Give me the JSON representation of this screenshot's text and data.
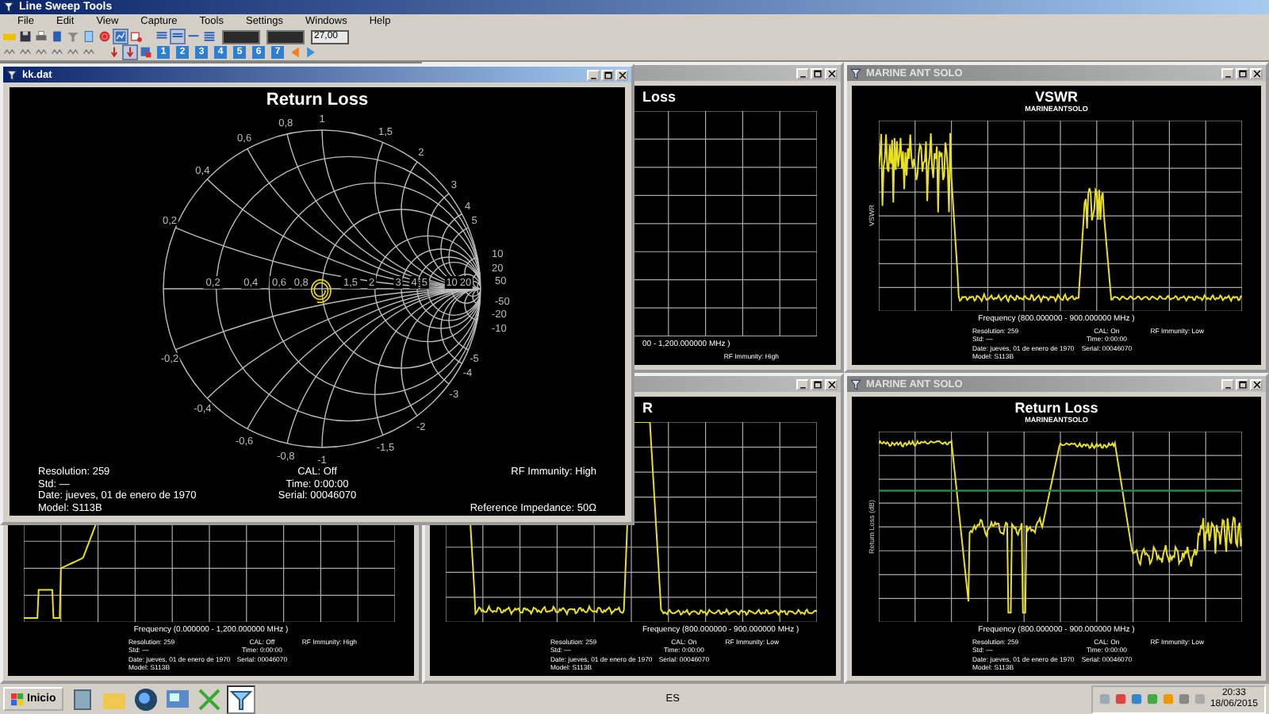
{
  "window": {
    "title": "Line Sweep Tools"
  },
  "menu": [
    {
      "label": "File"
    },
    {
      "label": "Edit"
    },
    {
      "label": "View"
    },
    {
      "label": "Capture"
    },
    {
      "label": "Tools"
    },
    {
      "label": "Settings"
    },
    {
      "label": "Windows"
    },
    {
      "label": "Help"
    }
  ],
  "toolbar": {
    "value": "27,00",
    "number_buttons": [
      "1",
      "2",
      "3",
      "4",
      "5",
      "6",
      "7"
    ]
  },
  "documents": [
    {
      "active": false,
      "chart_title": "Loss",
      "freq": "00 - 1,200.000000 MHz )",
      "info": {
        "right": [
          "RF Immunity: High"
        ]
      }
    },
    {
      "active": false,
      "title": "MARINE ANT SOLO",
      "kind": "vswr",
      "chart_title": "VSWR",
      "subtitle": "MARINEANTSOLO",
      "ylabel": "VSWR",
      "freq": "Frequency (800.000000 - 900.000000 MHz )",
      "info": {
        "left": [
          "Resolution: 259",
          "Std: —",
          "Date: jueves, 01 de enero de 1970",
          "Model: S113B"
        ],
        "center": [
          "CAL: On",
          "Time: 0:00:00",
          "Serial: 00046070"
        ],
        "right": [
          "RF Immunity: Low"
        ]
      }
    },
    {
      "kind": "wide",
      "freq": "Frequency (0.000000 - 1,200.000000 MHz )",
      "info": {
        "left": [
          "Resolution: 259",
          "Std: —",
          "Date: jueves, 01 de enero de 1970",
          "Model: S113B"
        ],
        "center": [
          "CAL: Off",
          "Time: 0:00:00",
          "Serial: 00046070"
        ],
        "right": [
          "RF Immunity: High"
        ]
      }
    },
    {
      "active": false,
      "kind": "vswr2",
      "chart_title": "R",
      "freq": "Frequency (800.000000 - 900.000000 MHz )",
      "info": {
        "left": [
          "Resolution: 259",
          "Std: —",
          "Date: jueves, 01 de enero de 1970",
          "Model: S113B"
        ],
        "center": [
          "CAL: On",
          "Time: 0:00:00",
          "Serial: 00046070"
        ],
        "right": [
          "RF Immunity: Low"
        ]
      }
    },
    {
      "active": false,
      "title": "MARINE ANT SOLO",
      "kind": "rl",
      "limit": true,
      "chart_title": "Return Loss",
      "subtitle": "MARINEANTSOLO",
      "ylabel": "Return Loss (dB)",
      "freq": "Frequency (800.000000 - 900.000000 MHz )",
      "info": {
        "left": [
          "Resolution: 259",
          "Std: —",
          "Date: jueves, 01 de enero de 1970",
          "Model: S113B"
        ],
        "center": [
          "CAL: On",
          "Time: 0:00:00",
          "Serial: 00046070"
        ],
        "right": [
          "RF Immunity: Low"
        ]
      }
    }
  ],
  "smith_window": {
    "title": "kk.dat",
    "active": true,
    "chart_title": "Return Loss",
    "real_labels": [
      "0,2",
      "0,4",
      "0,6",
      "0,8",
      "1,5",
      "2",
      "3",
      "4",
      "5",
      "10",
      "20"
    ],
    "top_labels": [
      "0,2",
      "0,4",
      "0,6",
      "0,8",
      "1",
      "1,5",
      "2",
      "3",
      "4",
      "5",
      "10",
      "20",
      "50"
    ],
    "bottom_labels": [
      "-0,2",
      "-0,4",
      "-0,6",
      "-0,8",
      "-1",
      "-1,5",
      "-2",
      "-3",
      "-4",
      "-5",
      "-50",
      "-20",
      "-10"
    ],
    "info": {
      "left": [
        "Resolution: 259",
        "Std: —",
        "Date: jueves, 01 de enero de 1970",
        "Model: S113B"
      ],
      "center": [
        "CAL: Off",
        "Time: 0:00:00",
        "Serial: 00046070"
      ],
      "right": [
        "RF Immunity: High",
        "Reference Impedance: 50Ω"
      ]
    }
  },
  "taskbar": {
    "start": "Inicio",
    "language": "ES",
    "time": "20:33",
    "date": "18/06/2015"
  }
}
